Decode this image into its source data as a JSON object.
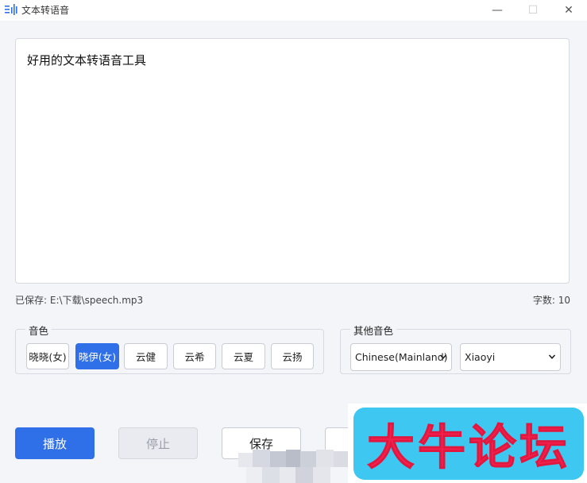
{
  "window": {
    "title": "文本转语音",
    "icon": "waveform-icon",
    "controls": {
      "minimize": "—",
      "maximize": "☐",
      "close": "✕"
    }
  },
  "editor": {
    "text": "好用的文本转语音工具"
  },
  "status": {
    "saved_path": "已保存: E:\\下载\\speech.mp3",
    "char_count": "字数: 10"
  },
  "voice_group": {
    "label": "音色",
    "voices": [
      {
        "label": "晓晓(女)",
        "selected": false
      },
      {
        "label": "晓伊(女)",
        "selected": true
      },
      {
        "label": "云健",
        "selected": false
      },
      {
        "label": "云希",
        "selected": false
      },
      {
        "label": "云夏",
        "selected": false
      },
      {
        "label": "云扬",
        "selected": false
      }
    ]
  },
  "other_voice_group": {
    "label": "其他音色",
    "language_select": "Chinese(Mainland)",
    "voice_select": "Xiaoyi"
  },
  "actions": {
    "play": "播放",
    "stop": "停止",
    "save": "保存"
  },
  "watermark": {
    "text": "大牛论坛"
  },
  "colors": {
    "accent": "#2f6fe8",
    "background": "#f4f5f9",
    "watermark_bg": "#3ec7f0",
    "watermark_text": "#f3214d"
  }
}
